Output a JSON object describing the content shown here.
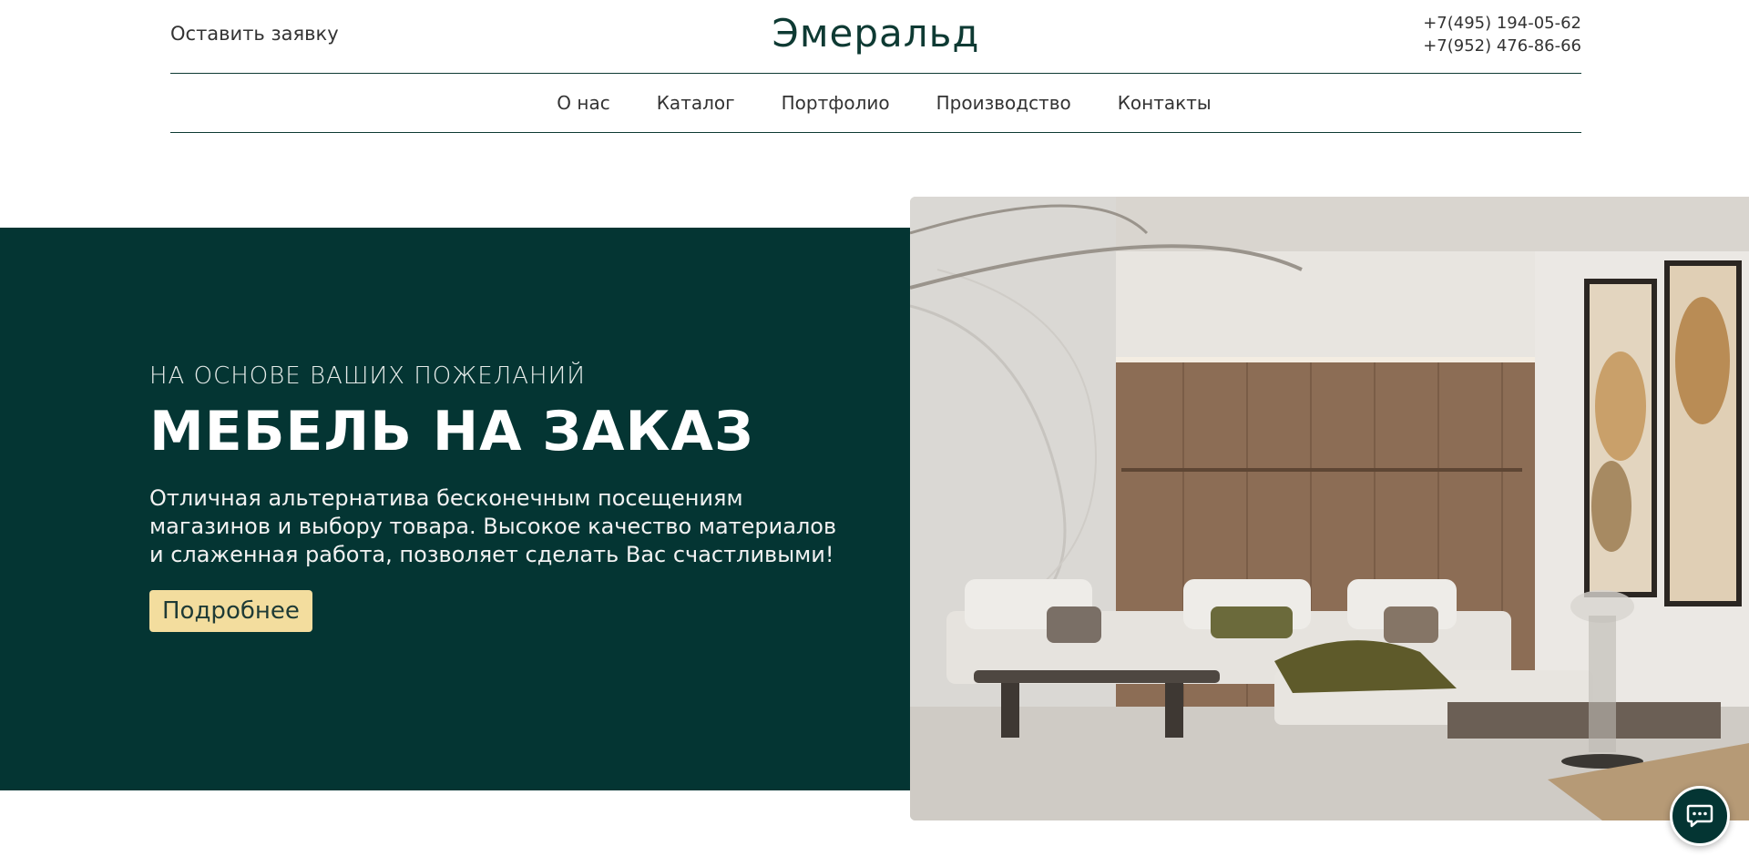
{
  "header": {
    "request_label": "Оставить заявку",
    "brand": "Эмеральд",
    "phones": [
      "+7(495) 194-05-62",
      "+7(952) 476-86-66"
    ]
  },
  "nav": {
    "items": [
      "О нас",
      "Каталог",
      "Портфолио",
      "Производство",
      "Контакты"
    ]
  },
  "hero": {
    "eyebrow": "НА ОСНОВЕ ВАШИХ ПОЖЕЛАНИЙ",
    "title": "МЕБЕЛЬ НА ЗАКАЗ",
    "description": "Отличная альтернатива бесконечным посещениям магазинов и выбору товара. Высокое качество материалов и слаженная работа, позволяет сделать Вас счастливыми!",
    "cta_label": "Подробнее"
  },
  "widgets": {
    "chat_icon": "chat-icon"
  },
  "colors": {
    "brand_dark_green": "#043533",
    "accent_beige": "#f3dd9e"
  }
}
